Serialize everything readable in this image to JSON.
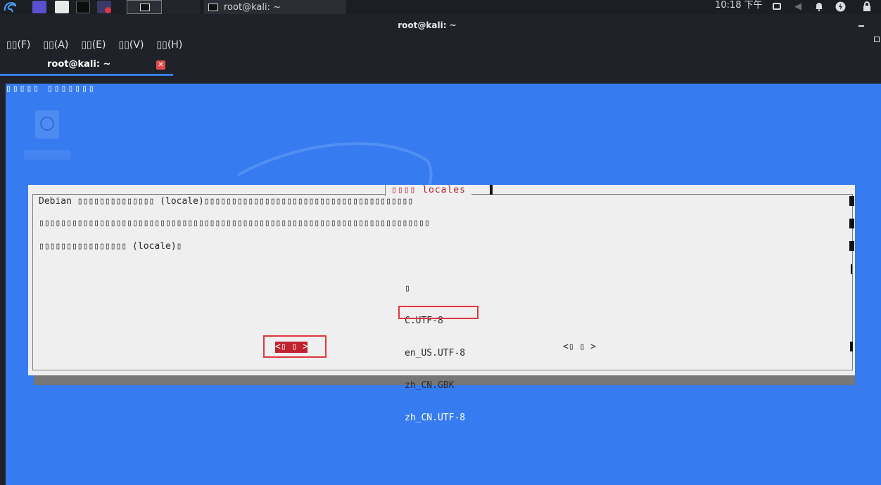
{
  "panel": {
    "clock": "10:18 下午",
    "task_main_title": "root@kali: ~"
  },
  "window": {
    "title": "root@kali: ~"
  },
  "menubar": {
    "items": [
      "▯▯(F)",
      "▯▯(A)",
      "▯▯(E)",
      "▯▯(V)",
      "▯▯(H)"
    ]
  },
  "tab": {
    "label": "root@kali: ~",
    "close": "✕"
  },
  "terminal": {
    "backtitle": "▯▯▯▯▯ ▯▯▯▯▯▯▯",
    "dialog": {
      "title": "▯▯▯▯  locales",
      "line1": "Debian ▯▯▯▯▯▯▯▯▯▯▯▯▯▯ (locale)▯▯▯▯▯▯▯▯▯▯▯▯▯▯▯▯▯▯▯▯▯▯▯▯▯▯▯▯▯▯▯▯▯▯▯▯▯▯",
      "line2": "▯▯▯▯▯▯▯▯▯▯▯▯▯▯▯▯▯▯▯▯▯▯▯▯▯▯▯▯▯▯▯▯▯▯▯▯▯▯▯▯▯▯▯▯▯▯▯▯▯▯▯▯▯▯▯▯▯▯▯▯▯▯▯▯▯▯▯▯▯▯▯",
      "line3": "▯▯▯▯▯▯▯▯▯▯▯▯▯▯▯▯ (locale)▯",
      "options": [
        "▯",
        "C.UTF-8",
        "en_US.UTF-8",
        "zh_CN.GBK"
      ],
      "selected_option": "zh_CN.UTF-8",
      "ok_button": "<▯ ▯ >",
      "cancel_button": "<▯ ▯ >"
    }
  },
  "colors": {
    "terminal_bg": "#367bf0",
    "dialog_bg": "#efefef",
    "accent_red": "#c2212e",
    "annotation_red": "#e0363f"
  }
}
